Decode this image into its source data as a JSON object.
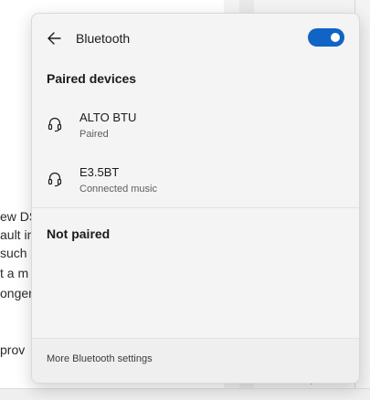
{
  "background_doc": {
    "lines": [
      "ew DS",
      "ault in",
      " such",
      "t a m",
      "onger",
      "",
      "prov"
    ]
  },
  "flyout": {
    "title": "Bluetooth",
    "back_icon": "back-arrow-icon",
    "toggle": {
      "state": "on",
      "color": "#0f64c5"
    },
    "paired_section": "Paired devices",
    "paired_devices": [
      {
        "name": "ALTO BTU",
        "status": "Paired",
        "icon": "headset-icon"
      },
      {
        "name": "E3.5BT",
        "status": "Connected music",
        "icon": "headset-icon"
      }
    ],
    "not_paired_section": "Not paired",
    "footer_link": "More Bluetooth settings"
  }
}
